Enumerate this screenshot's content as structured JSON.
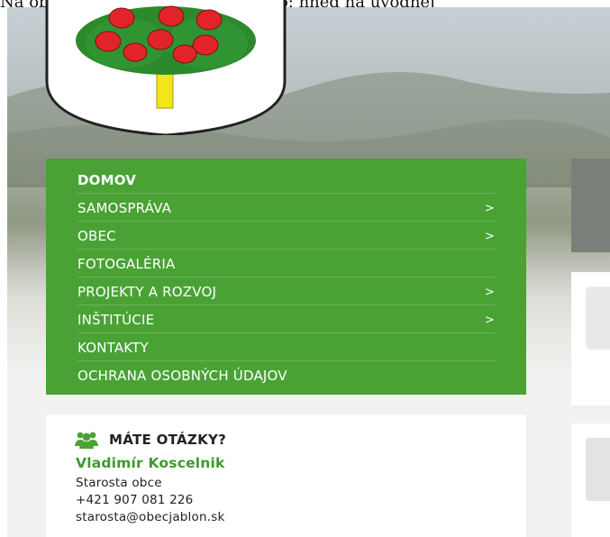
{
  "caption": "Na obecnej stránke to vyzera takto: hned na uvodnej",
  "menu": {
    "items": [
      {
        "label": "DOMOV",
        "has_submenu": false
      },
      {
        "label": "SAMOSPRÁVA",
        "has_submenu": true
      },
      {
        "label": "OBEC",
        "has_submenu": true
      },
      {
        "label": "FOTOGALÉRIA",
        "has_submenu": false
      },
      {
        "label": "PROJEKTY A ROZVOJ",
        "has_submenu": true
      },
      {
        "label": "INŠTITÚCIE",
        "has_submenu": true
      },
      {
        "label": "KONTAKTY",
        "has_submenu": false
      },
      {
        "label": "OCHRANA OSOBNÝCH ÚDAJOV",
        "has_submenu": false
      }
    ],
    "chevron": ">",
    "color": "#4aa235"
  },
  "contact": {
    "title": "MÁTE OTÁZKY?",
    "icon": "people-icon",
    "name": "Vladimír Koscelnik",
    "role": "Starosta obce",
    "phone": "+421 907 081 226",
    "email": "starosta@obecjablon.sk",
    "accent": "#3e9a2c"
  }
}
